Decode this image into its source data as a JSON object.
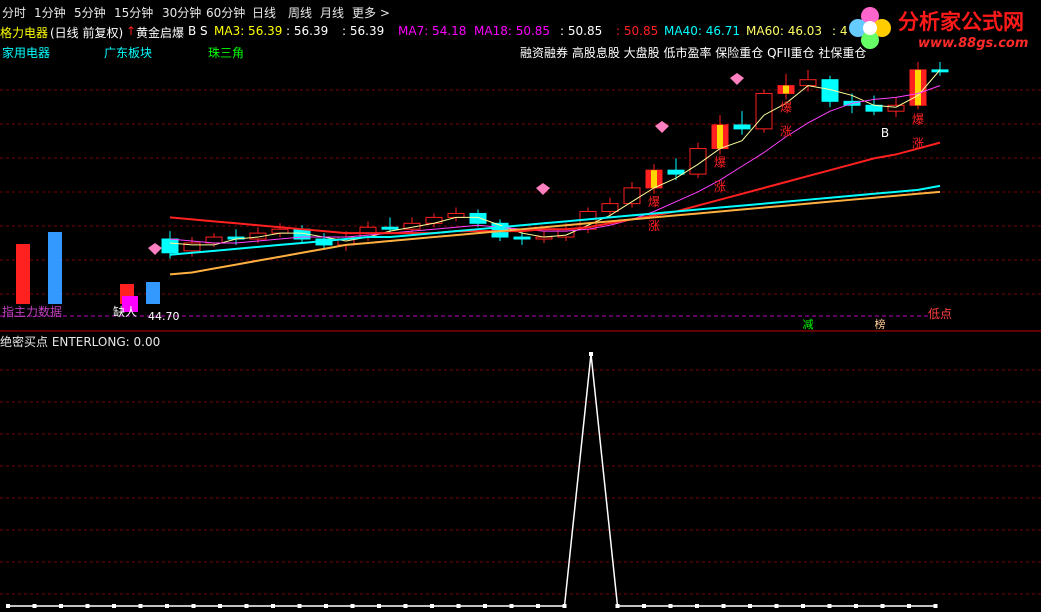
{
  "periods": [
    "分时",
    "1分钟",
    "5分钟",
    "15分钟",
    "30分钟",
    "60分钟",
    "日线",
    "周线",
    "月线",
    "更多 >"
  ],
  "logo": {
    "text": "分析家公式网",
    "url": "www.88gs.com"
  },
  "stock": {
    "name": "格力电器",
    "mode": "(日线 前复权)"
  },
  "indicator": {
    "name": "黄金启爆",
    "b_label": "B",
    "s_label": "S"
  },
  "ma_values": [
    {
      "label": "MA3: 56.39",
      "color": "#ffff00"
    },
    {
      "label": ": 56.39",
      "color": "#ffffff"
    },
    {
      "label": ": 56.39",
      "color": "#ffffff"
    },
    {
      "label": "MA7: 54.18",
      "color": "#ff00ff"
    },
    {
      "label": "MA18: 50.85",
      "color": "#ff00ff"
    },
    {
      "label": ": 50.85",
      "color": "#ffffff"
    },
    {
      "label": ": 50.85",
      "color": "#ff2020"
    },
    {
      "label": "MA40: 46.71",
      "color": "#00ffff"
    },
    {
      "label": "MA60: 46.03",
      "color": "#ffff66"
    },
    {
      "label": ": 4",
      "color": "#ffff66"
    }
  ],
  "tags": {
    "industry": "家用电器",
    "region": "广东板块",
    "concept": "珠三角",
    "themes": "融资融券 高股息股 大盘股 低市盈率 保险重仓 QFII重仓 社保重仓"
  },
  "annotations": {
    "bao": "爆",
    "zhang": "涨",
    "jian": "减",
    "bang": "榜",
    "low_point": "低点",
    "lower_left": "指主力数据",
    "buy_hint": "缺人",
    "b_marker": "B",
    "left_price": "44.70"
  },
  "lower_panel": {
    "title": "绝密买点",
    "series": "ENTERLONG: 0.00"
  },
  "colors": {
    "background": "#000000",
    "up": "#ff2020",
    "down": "#00ffff",
    "grid": "#7a0000",
    "ma3": "#ffff99",
    "ma7": "#ff40ff",
    "ma18": "#ff2020",
    "ma40": "#00ffff",
    "ma60": "#ffb040"
  },
  "chart_data": [
    {
      "type": "candlestick",
      "title": "格力电器(日线 前复权)",
      "ylim": [
        44.7,
        56.8
      ],
      "candles": [
        [
          47.8,
          47.1,
          48.2,
          46.8
        ],
        [
          47.2,
          47.6,
          47.9,
          46.9
        ],
        [
          47.6,
          47.9,
          48.1,
          47.4
        ],
        [
          47.9,
          47.8,
          48.3,
          47.5
        ],
        [
          47.8,
          48.1,
          48.4,
          47.6
        ],
        [
          48.1,
          48.3,
          48.6,
          47.9
        ],
        [
          48.3,
          47.8,
          48.5,
          47.6
        ],
        [
          47.8,
          47.5,
          48.1,
          47.3
        ],
        [
          47.5,
          47.9,
          48.2,
          47.2
        ],
        [
          47.9,
          48.4,
          48.7,
          47.7
        ],
        [
          48.4,
          48.3,
          48.9,
          48.1
        ],
        [
          48.3,
          48.6,
          48.9,
          48.1
        ],
        [
          48.6,
          48.9,
          49.1,
          48.4
        ],
        [
          48.9,
          49.1,
          49.4,
          48.7
        ],
        [
          49.1,
          48.6,
          49.3,
          48.4
        ],
        [
          48.6,
          47.9,
          48.8,
          47.7
        ],
        [
          47.9,
          47.8,
          48.2,
          47.5
        ],
        [
          47.8,
          47.9,
          48.2,
          47.6
        ],
        [
          47.9,
          48.3,
          48.6,
          47.7
        ],
        [
          48.3,
          49.2,
          49.4,
          48.1
        ],
        [
          49.2,
          49.6,
          49.9,
          48.9
        ],
        [
          49.6,
          50.4,
          50.7,
          49.4
        ],
        [
          50.4,
          51.3,
          51.6,
          50.1
        ],
        [
          51.3,
          51.1,
          51.9,
          50.8
        ],
        [
          51.1,
          52.4,
          52.7,
          50.9
        ],
        [
          52.4,
          53.6,
          54.1,
          52.1
        ],
        [
          53.6,
          53.4,
          54.3,
          53.1
        ],
        [
          53.4,
          55.2,
          55.4,
          53.2
        ],
        [
          55.2,
          55.6,
          56.2,
          54.9
        ],
        [
          55.6,
          55.9,
          56.4,
          55.3
        ],
        [
          55.9,
          54.8,
          56.1,
          54.5
        ],
        [
          54.8,
          54.6,
          55.2,
          54.2
        ],
        [
          54.6,
          54.3,
          55.1,
          54.1
        ],
        [
          54.3,
          54.6,
          55.0,
          54.0
        ],
        [
          54.6,
          56.4,
          56.8,
          54.4
        ],
        [
          56.4,
          56.3,
          56.8,
          56.1
        ]
      ],
      "moving_averages": [
        {
          "name": "MA3",
          "values": [
            47.6,
            47.5,
            47.5,
            47.8,
            47.9,
            48.1,
            48.1,
            47.9,
            47.7,
            47.9,
            48.2,
            48.4,
            48.6,
            48.9,
            48.9,
            48.5,
            48.1,
            47.9,
            48.0,
            48.5,
            49.0,
            49.7,
            50.4,
            50.9,
            51.6,
            52.4,
            52.8,
            54.1,
            54.7,
            55.6,
            55.4,
            55.1,
            54.6,
            54.5,
            55.1,
            56.4
          ]
        },
        {
          "name": "MA7",
          "values": [
            47.8,
            47.7,
            47.6,
            47.6,
            47.7,
            47.8,
            47.9,
            47.9,
            47.9,
            48.0,
            48.1,
            48.2,
            48.3,
            48.4,
            48.5,
            48.4,
            48.3,
            48.2,
            48.2,
            48.3,
            48.5,
            48.8,
            49.2,
            49.7,
            50.2,
            50.8,
            51.5,
            52.2,
            53.0,
            53.7,
            54.3,
            54.7,
            54.9,
            55.0,
            55.2,
            55.6
          ]
        },
        {
          "name": "MA18",
          "values": [
            48.9,
            48.8,
            48.7,
            48.6,
            48.5,
            48.4,
            48.3,
            48.2,
            48.1,
            48.1,
            48.1,
            48.1,
            48.1,
            48.2,
            48.2,
            48.2,
            48.2,
            48.3,
            48.3,
            48.4,
            48.6,
            48.8,
            49.0,
            49.2,
            49.5,
            49.8,
            50.1,
            50.4,
            50.7,
            51.0,
            51.3,
            51.6,
            51.9,
            52.1,
            52.4,
            52.7
          ]
        },
        {
          "name": "MA40",
          "values": [
            47.0,
            47.1,
            47.2,
            47.3,
            47.4,
            47.5,
            47.6,
            47.7,
            47.8,
            47.9,
            47.9,
            48.0,
            48.1,
            48.2,
            48.3,
            48.4,
            48.5,
            48.6,
            48.7,
            48.8,
            48.9,
            49.0,
            49.1,
            49.2,
            49.3,
            49.4,
            49.5,
            49.6,
            49.7,
            49.8,
            49.9,
            50.0,
            50.1,
            50.2,
            50.3,
            50.5
          ]
        },
        {
          "name": "MA60",
          "values": [
            46.0,
            46.1,
            46.3,
            46.5,
            46.7,
            46.9,
            47.1,
            47.3,
            47.5,
            47.6,
            47.7,
            47.8,
            47.9,
            48.0,
            48.1,
            48.2,
            48.3,
            48.4,
            48.5,
            48.6,
            48.7,
            48.8,
            48.9,
            49.0,
            49.1,
            49.2,
            49.3,
            49.4,
            49.5,
            49.6,
            49.7,
            49.8,
            49.9,
            50.0,
            50.1,
            50.2
          ]
        }
      ],
      "signals": [
        {
          "index": 22,
          "label": "爆涨"
        },
        {
          "index": 25,
          "label": "爆涨"
        },
        {
          "index": 28,
          "label": "爆涨"
        },
        {
          "index": 34,
          "label": "爆涨"
        }
      ]
    },
    {
      "type": "line",
      "title": "绝密买点",
      "series": [
        {
          "name": "ENTERLONG",
          "values": [
            0,
            0,
            0,
            0,
            0,
            0,
            0,
            0,
            0,
            0,
            0,
            0,
            0,
            0,
            0,
            0,
            0,
            0,
            0,
            0,
            0,
            0,
            1,
            0,
            0,
            0,
            0,
            0,
            0,
            0,
            0,
            0,
            0,
            0,
            0,
            0
          ]
        }
      ],
      "ylim": [
        0,
        1
      ]
    }
  ]
}
